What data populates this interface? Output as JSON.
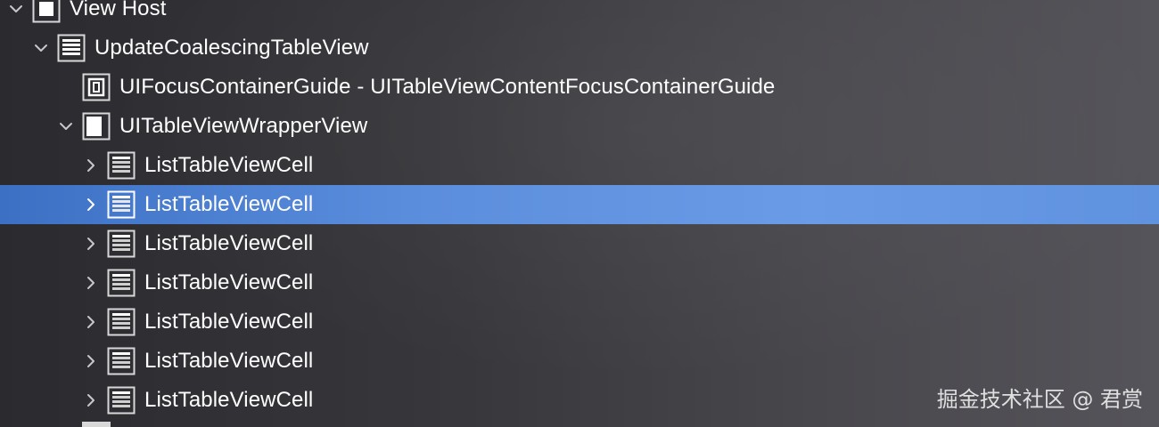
{
  "tree": {
    "rows": [
      {
        "label": "View Host",
        "expanded": true,
        "icon": "view-icon"
      },
      {
        "label": "UpdateCoalescingTableView",
        "expanded": true,
        "icon": "table-view-icon"
      },
      {
        "label": "UIFocusContainerGuide - UITableViewContentFocusContainerGuide",
        "icon": "focus-guide-icon"
      },
      {
        "label": "UITableViewWrapperView",
        "expanded": true,
        "icon": "wrapper-view-icon"
      },
      {
        "label": "ListTableViewCell",
        "expanded": false,
        "icon": "table-cell-icon"
      },
      {
        "label": "ListTableViewCell",
        "expanded": false,
        "icon": "table-cell-icon",
        "selected": true
      },
      {
        "label": "ListTableViewCell",
        "expanded": false,
        "icon": "table-cell-icon"
      },
      {
        "label": "ListTableViewCell",
        "expanded": false,
        "icon": "table-cell-icon"
      },
      {
        "label": "ListTableViewCell",
        "expanded": false,
        "icon": "table-cell-icon"
      },
      {
        "label": "ListTableViewCell",
        "expanded": false,
        "icon": "table-cell-icon"
      },
      {
        "label": "ListTableViewCell",
        "expanded": false,
        "icon": "table-cell-icon"
      }
    ]
  },
  "watermark": "掘金技术社区 @ 君赏",
  "colors": {
    "selection": "#5a8ddc",
    "background": "#38383c",
    "text": "#ffffff"
  }
}
